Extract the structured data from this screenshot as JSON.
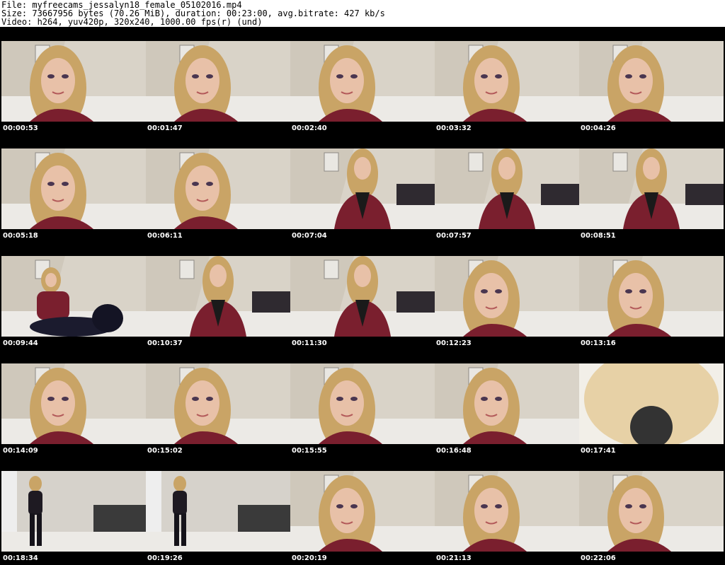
{
  "header": {
    "file": "File: myfreecams_jessalyn18_female_05102016.mp4",
    "size": "Size: 73667956 bytes (70.26 MiB), duration: 00:23:00, avg.bitrate: 427 kb/s",
    "video": "Video: h264, yuv420p, 320x240, 1000.00 fps(r) (und)"
  },
  "colors": {
    "background": "#000000",
    "header_bg": "#ffffff",
    "wall": "#d9d3c8",
    "hair": "#c9a466",
    "skin": "#e8c1a8",
    "shirt": "#7a1f2e",
    "bed": "#eceae6"
  },
  "thumbnails": [
    {
      "timestamp": "00:00:53",
      "scene": "face"
    },
    {
      "timestamp": "00:01:47",
      "scene": "face"
    },
    {
      "timestamp": "00:02:40",
      "scene": "face"
    },
    {
      "timestamp": "00:03:32",
      "scene": "face"
    },
    {
      "timestamp": "00:04:26",
      "scene": "face"
    },
    {
      "timestamp": "00:05:18",
      "scene": "face"
    },
    {
      "timestamp": "00:06:11",
      "scene": "face"
    },
    {
      "timestamp": "00:07:04",
      "scene": "half"
    },
    {
      "timestamp": "00:07:57",
      "scene": "half"
    },
    {
      "timestamp": "00:08:51",
      "scene": "half"
    },
    {
      "timestamp": "00:09:44",
      "scene": "sitting"
    },
    {
      "timestamp": "00:10:37",
      "scene": "half"
    },
    {
      "timestamp": "00:11:30",
      "scene": "half"
    },
    {
      "timestamp": "00:12:23",
      "scene": "face"
    },
    {
      "timestamp": "00:13:16",
      "scene": "face"
    },
    {
      "timestamp": "00:14:09",
      "scene": "face"
    },
    {
      "timestamp": "00:15:02",
      "scene": "face"
    },
    {
      "timestamp": "00:15:55",
      "scene": "face"
    },
    {
      "timestamp": "00:16:48",
      "scene": "face"
    },
    {
      "timestamp": "00:17:41",
      "scene": "blur"
    },
    {
      "timestamp": "00:18:34",
      "scene": "standing"
    },
    {
      "timestamp": "00:19:26",
      "scene": "standing"
    },
    {
      "timestamp": "00:20:19",
      "scene": "face"
    },
    {
      "timestamp": "00:21:13",
      "scene": "face"
    },
    {
      "timestamp": "00:22:06",
      "scene": "face"
    }
  ]
}
